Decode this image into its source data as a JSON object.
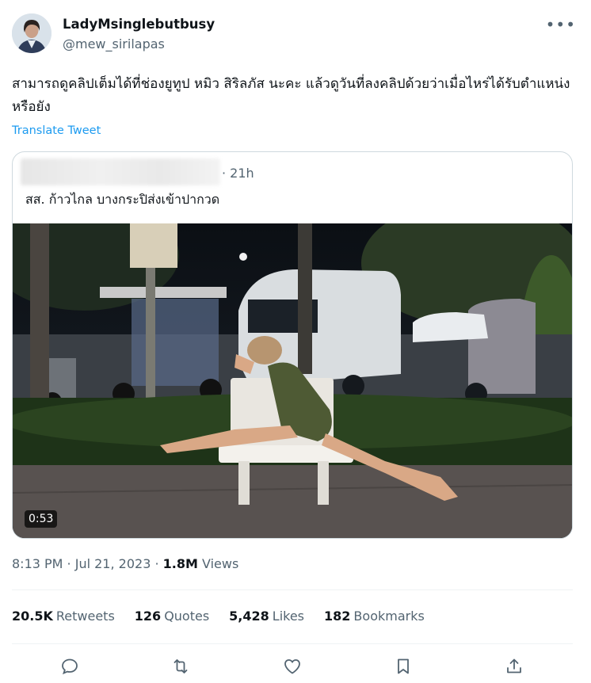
{
  "author": {
    "display_name": "LadyMsinglebutbusy",
    "handle": "@mew_sirilapas",
    "more_icon": "more-horizontal-icon"
  },
  "tweet": {
    "text": "สามารถดูคลิปเต็มได้ที่ช่องยูทูป หมิว สิริลภัส นะคะ แล้วดูวันที่ลงคลิปด้วยว่าเมื่อไหร่ได้รับตำแหน่งหรือยัง",
    "translate_label": "Translate Tweet"
  },
  "quote": {
    "time": "· 21h",
    "text": "สส. ก้าวไกล บางกระปิส่งเข้าปากวด",
    "video_duration": "0:53"
  },
  "meta": {
    "time": "8:13 PM",
    "separator1": " · ",
    "date": "Jul 21, 2023",
    "separator2": " · ",
    "views_count": "1.8M",
    "views_label": "Views"
  },
  "stats": {
    "retweets_count": "20.5K",
    "retweets_label": "Retweets",
    "quotes_count": "126",
    "quotes_label": "Quotes",
    "likes_count": "5,428",
    "likes_label": "Likes",
    "bookmarks_count": "182",
    "bookmarks_label": "Bookmarks"
  },
  "actions": [
    "reply-icon",
    "retweet-icon",
    "like-icon",
    "bookmark-icon",
    "share-icon"
  ],
  "colors": {
    "accent": "#1d9bf0",
    "secondary_text": "#536471",
    "border": "#cfd9de"
  }
}
